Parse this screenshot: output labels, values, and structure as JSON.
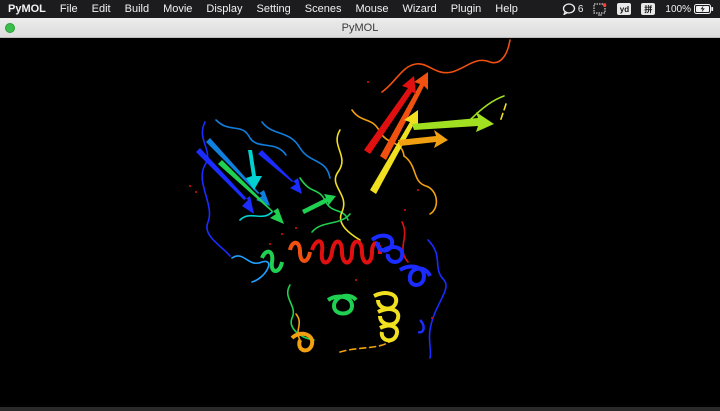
{
  "menubar": {
    "app_name": "PyMOL",
    "items": [
      "File",
      "Edit",
      "Build",
      "Movie",
      "Display",
      "Setting",
      "Scenes",
      "Mouse",
      "Wizard",
      "Plugin",
      "Help"
    ],
    "notification_count": "6",
    "input_badge_1": "yd",
    "input_badge_2": "拼",
    "battery": "100%"
  },
  "window": {
    "title": "PyMOL"
  },
  "viewport": {
    "background": "#000000",
    "rainbow_colors": [
      "#1a2cff",
      "#0f7fe0",
      "#00d0d0",
      "#20d050",
      "#a0e020",
      "#f0e020",
      "#f0a010",
      "#f05010",
      "#e01010"
    ]
  }
}
